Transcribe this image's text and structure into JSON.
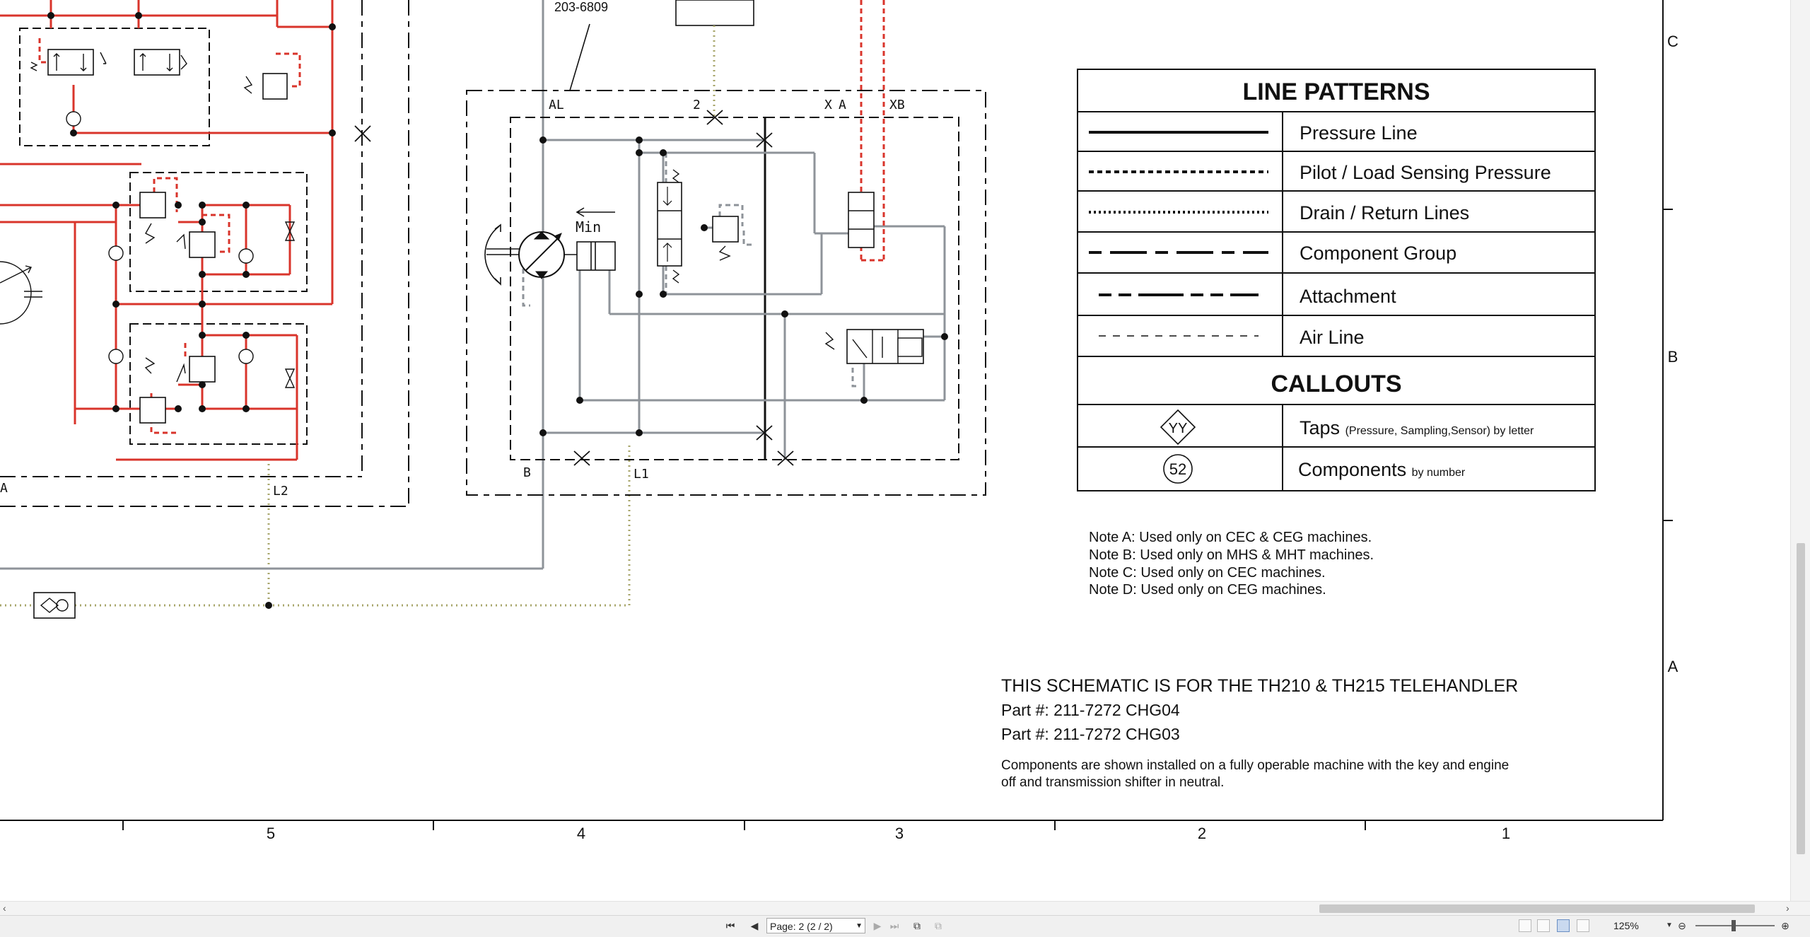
{
  "document": {
    "title": "THIS SCHEMATIC IS FOR THE TH210 & TH215 TELEHANDLER",
    "part_numbers": [
      "Part #: 211-7272 CHG04",
      "Part #: 211-7272 CHG03"
    ],
    "description": [
      "Components are shown installed on a fully operable machine with the key and engine",
      "off and transmission shifter in neutral."
    ],
    "notes": [
      "Note A: Used only on CEC & CEG machines.",
      "Note B: Used only on MHS & MHT machines.",
      "Note C: Used only on CEC machines.",
      "Note D: Used only on CEG machines."
    ],
    "legend": {
      "line_patterns_title": "LINE PATTERNS",
      "items": [
        "Pressure Line",
        "Pilot / Load Sensing Pressure",
        "Drain / Return Lines",
        "Component Group",
        "Attachment",
        "Air Line"
      ],
      "callouts_title": "CALLOUTS",
      "tap_symbol": "YY",
      "tap_label": "Taps",
      "tap_sub": "(Pressure, Sampling,Sensor) by letter",
      "component_symbol": "52",
      "component_label": "Components",
      "component_sub": "by number"
    },
    "grid_columns": [
      "5",
      "4",
      "3",
      "2",
      "1"
    ],
    "grid_rows": [
      "C",
      "B",
      "A"
    ],
    "labels": {
      "part_ref": "203-6809",
      "port_al": "AL",
      "port_2": "2",
      "port_x": "X",
      "port_a": "A",
      "port_xb": "XB",
      "port_b": "B",
      "port_l1": "L1",
      "port_l2": "L2",
      "port_a_left": "A",
      "min": "Min"
    },
    "colors": {
      "pressure": "#d9342b",
      "return": "#8e9399",
      "drain": "#a7a56a"
    }
  },
  "statusbar": {
    "page_label": "Page: 2 (2 / 2)",
    "zoom": "125%",
    "icons": [
      "first-page-icon",
      "prev-page-icon",
      "next-page-icon",
      "last-page-icon",
      "goto-back-icon",
      "goto-forward-icon"
    ]
  }
}
